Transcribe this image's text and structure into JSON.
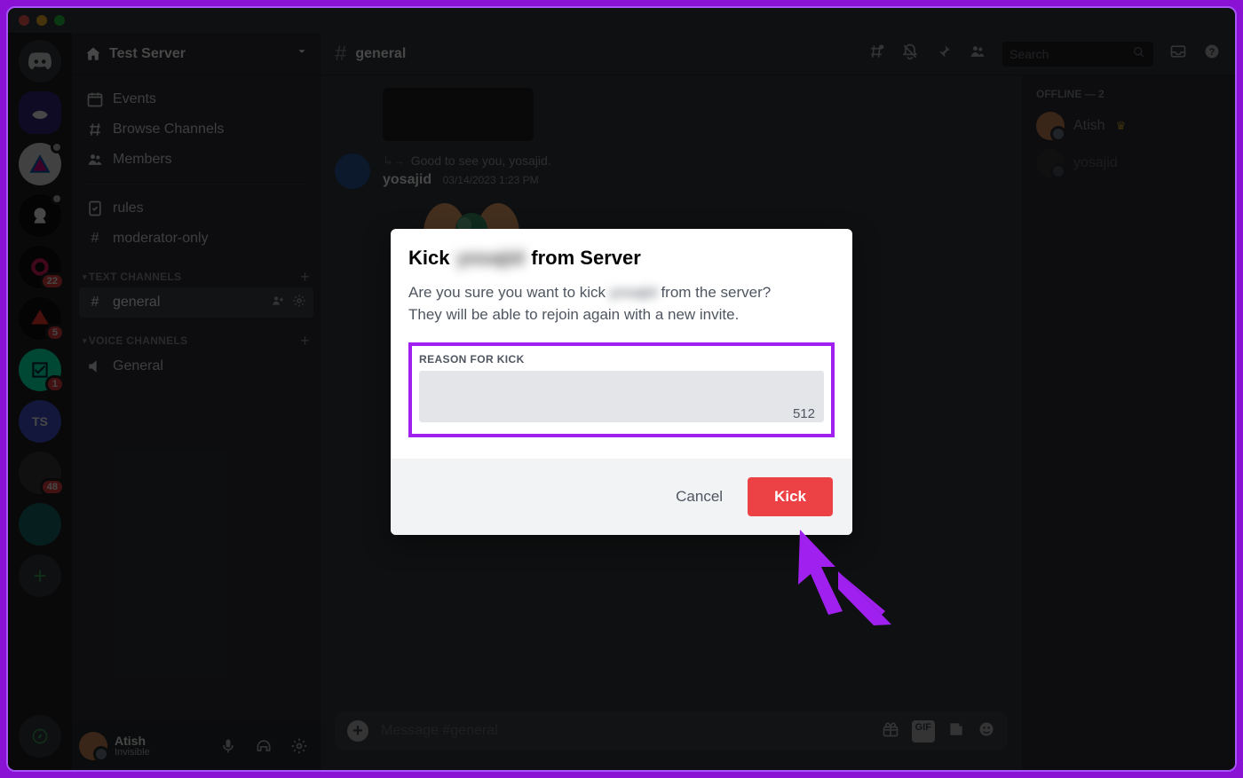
{
  "server": {
    "name": "Test Server"
  },
  "guildBadges": {
    "p": "22",
    "v": "5",
    "ts": "1",
    "photo": "48"
  },
  "sidebar": {
    "events": "Events",
    "browse": "Browse Channels",
    "members": "Members",
    "rules": "rules",
    "moderator": "moderator-only",
    "catText": "TEXT CHANNELS",
    "general": "general",
    "catVoice": "VOICE CHANNELS",
    "voiceGeneral": "General"
  },
  "userPanel": {
    "name": "Atish",
    "status": "Invisible"
  },
  "channelHeader": {
    "title": "general",
    "searchPlaceholder": "Search"
  },
  "chat": {
    "replyLine": "Good to see you, yosajid.",
    "msgUser": "yosajid",
    "msgTime": "03/14/2023 1:23 PM",
    "inputPlaceholder": "Message #general"
  },
  "members": {
    "header": "OFFLINE — 2",
    "m1": "Atish",
    "m2": "yosajid"
  },
  "modal": {
    "titlePrefix": "Kick",
    "titleUser": "yosajid",
    "titleSuffix": "from Server",
    "desc1a": "Are you sure you want to kick",
    "desc1user": "yosajid",
    "desc1b": "from the server?",
    "desc2": "They will be able to rejoin again with a new invite.",
    "reasonLabel": "REASON FOR KICK",
    "charCount": "512",
    "cancel": "Cancel",
    "kick": "Kick"
  }
}
